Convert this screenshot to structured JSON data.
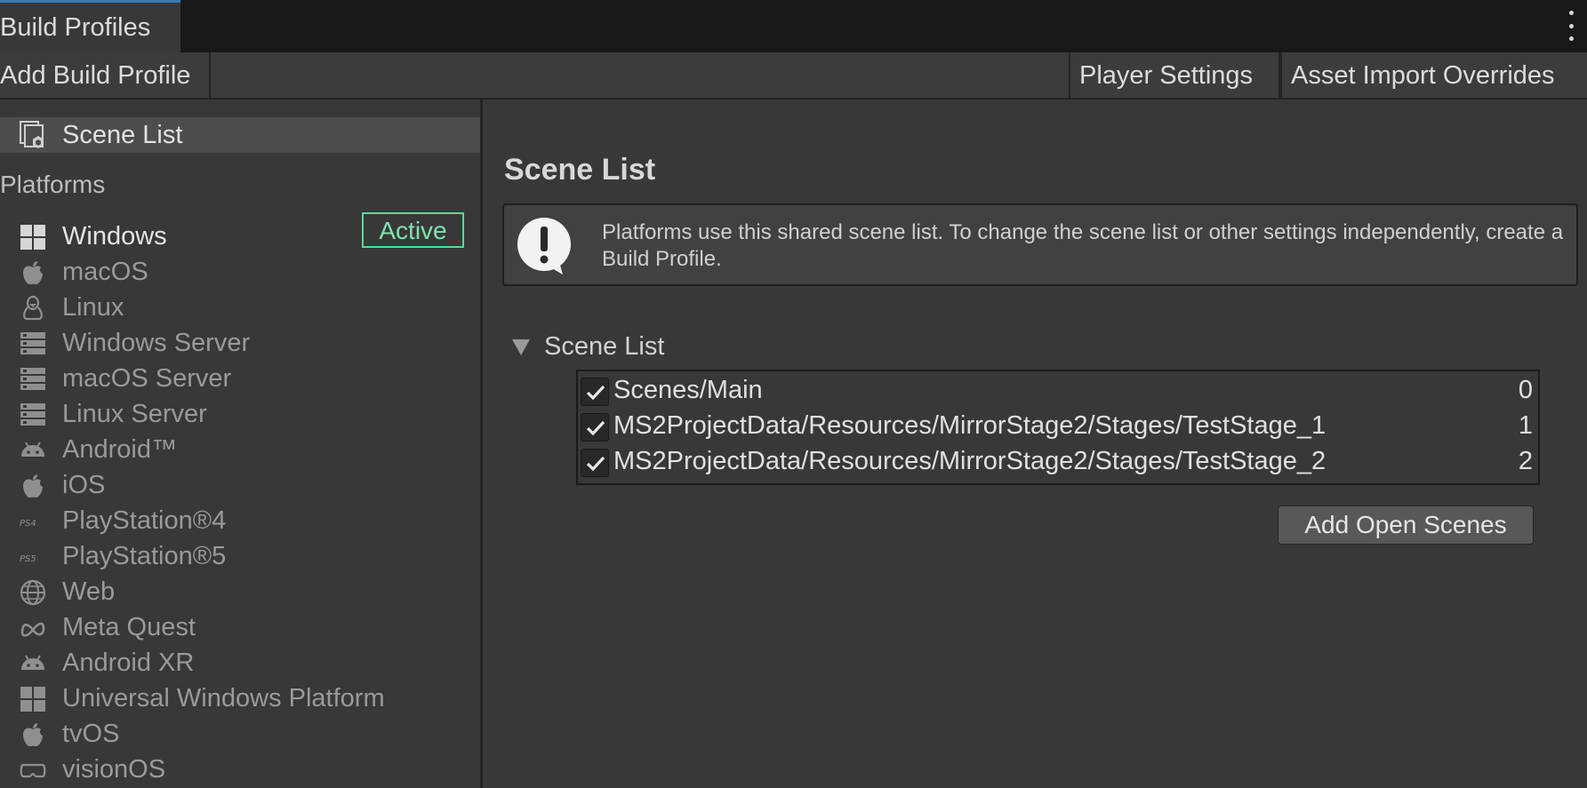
{
  "window": {
    "tab_title": "Build Profiles"
  },
  "toolbar": {
    "add_build_profile": "Add Build Profile",
    "player_settings": "Player Settings",
    "asset_import_overrides": "Asset Import Overrides"
  },
  "sidebar": {
    "scene_list_label": "Scene List",
    "platforms_header": "Platforms",
    "active_badge": "Active",
    "platforms": [
      {
        "label": "Windows",
        "icon": "windows-icon",
        "active": true
      },
      {
        "label": "macOS",
        "icon": "apple-icon"
      },
      {
        "label": "Linux",
        "icon": "linux-icon"
      },
      {
        "label": "Windows Server",
        "icon": "server-icon"
      },
      {
        "label": "macOS Server",
        "icon": "server-icon"
      },
      {
        "label": "Linux Server",
        "icon": "server-icon"
      },
      {
        "label": "Android™",
        "icon": "android-icon"
      },
      {
        "label": "iOS",
        "icon": "apple-icon"
      },
      {
        "label": "PlayStation®4",
        "icon": "ps4-icon"
      },
      {
        "label": "PlayStation®5",
        "icon": "ps5-icon"
      },
      {
        "label": "Web",
        "icon": "globe-icon"
      },
      {
        "label": "Meta Quest",
        "icon": "meta-icon"
      },
      {
        "label": "Android XR",
        "icon": "android-icon"
      },
      {
        "label": "Universal Windows Platform",
        "icon": "windows-icon"
      },
      {
        "label": "tvOS",
        "icon": "apple-icon"
      },
      {
        "label": "visionOS",
        "icon": "visionpro-icon"
      }
    ]
  },
  "main": {
    "title": "Scene List",
    "help_text": "Platforms use this shared scene list. To change the scene list or other settings independently, create a Build Profile.",
    "foldout_label": "Scene List",
    "scenes": [
      {
        "path": "Scenes/Main",
        "index": "0",
        "checked": true
      },
      {
        "path": "MS2ProjectData/Resources/MirrorStage2/Stages/TestStage_1",
        "index": "1",
        "checked": true
      },
      {
        "path": "MS2ProjectData/Resources/MirrorStage2/Stages/TestStage_2",
        "index": "2",
        "checked": true
      }
    ],
    "add_open_scenes": "Add Open Scenes"
  },
  "colors": {
    "background": "#383838",
    "tab_accent": "#3a79bb",
    "active_badge": "#5fd69c"
  }
}
